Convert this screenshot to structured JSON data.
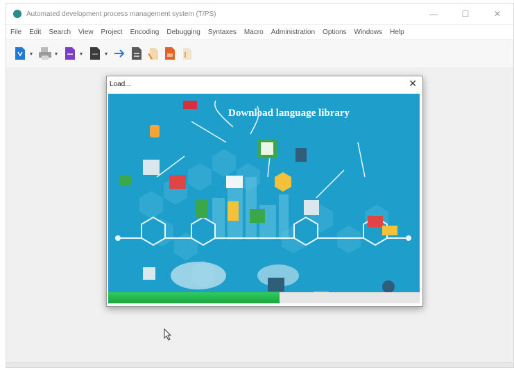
{
  "window": {
    "title": "Automated development process management system (T/PS)",
    "minimize_symbol": "—",
    "maximize_symbol": "☐",
    "close_symbol": "✕"
  },
  "menu": [
    "File",
    "Edit",
    "Search",
    "View",
    "Project",
    "Encoding",
    "Debugging",
    "Syntaxes",
    "Macro",
    "Administration",
    "Options",
    "Windows",
    "Help"
  ],
  "toolbar": {
    "icons": [
      "blue-doc-icon",
      "print-icon",
      "purple-doc-icon",
      "dark-doc-icon",
      "arrow-right-icon",
      "doc-icon",
      "orange-doc-icon",
      "red-doc-icon",
      "pale-doc-icon"
    ],
    "dropdown_symbol": "▾"
  },
  "dialog": {
    "title": "Load...",
    "close_symbol": "✕",
    "banner_title": "Download language library",
    "progress": 0.55
  },
  "colors": {
    "banner_bg": "#1e9fcb",
    "progress": "#22b14c"
  }
}
